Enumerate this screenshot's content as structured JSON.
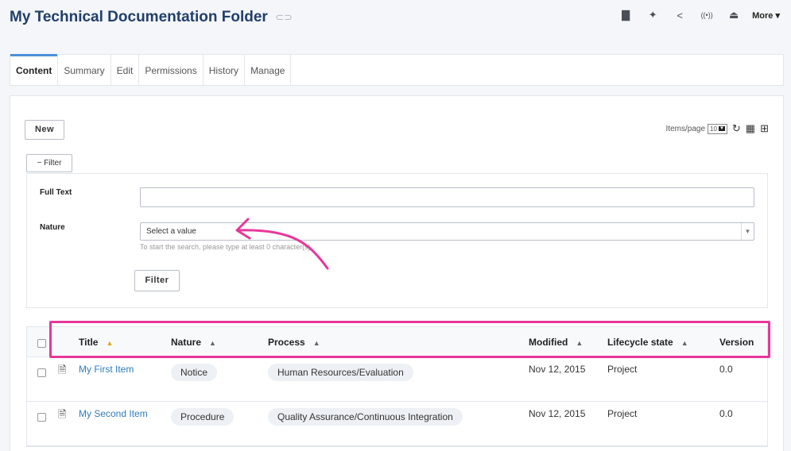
{
  "header": {
    "title": "My Technical Documentation Folder",
    "link_icon": "link-icon",
    "actions": [
      {
        "name": "book-icon",
        "glyph": "▇"
      },
      {
        "name": "pin-icon",
        "glyph": "✎"
      },
      {
        "name": "share-icon",
        "glyph": "<"
      },
      {
        "name": "broadcast-icon",
        "glyph": "((•))"
      },
      {
        "name": "upload-icon",
        "glyph": "⇪"
      }
    ],
    "more_label": "More ▾"
  },
  "tabs": [
    "Content",
    "Summary",
    "Edit",
    "Permissions",
    "History",
    "Manage"
  ],
  "toolbar": {
    "new_label": "New",
    "items_per_page_label": "Items/page",
    "items_per_page_value": "10",
    "refresh_icon": "refresh-icon",
    "calculator_icon": "calculator-icon",
    "columns_icon": "add-column-icon"
  },
  "filter": {
    "toggle_label": "− Filter",
    "full_text_label": "Full Text",
    "full_text_value": "",
    "nature_label": "Nature",
    "nature_placeholder": "Select a value",
    "nature_help": "To start the search, please type at least 0 character(s).",
    "submit_label": "Filter"
  },
  "table": {
    "columns": [
      "Title",
      "Nature",
      "Process",
      "Modified",
      "Lifecycle state",
      "Version"
    ],
    "rows": [
      {
        "title": "My First Item",
        "nature": "Notice",
        "process": "Human Resources/Evaluation",
        "modified": "Nov 12, 2015",
        "state": "Project",
        "version": "0.0"
      },
      {
        "title": "My Second Item",
        "nature": "Procedure",
        "process": "Quality Assurance/Continuous Integration",
        "modified": "Nov 12, 2015",
        "state": "Project",
        "version": "0.0"
      }
    ]
  },
  "colors": {
    "title": "#213f6a",
    "link": "#2f7cbd",
    "annotation": "#e8379b",
    "active_tab": "#4a90d9"
  }
}
